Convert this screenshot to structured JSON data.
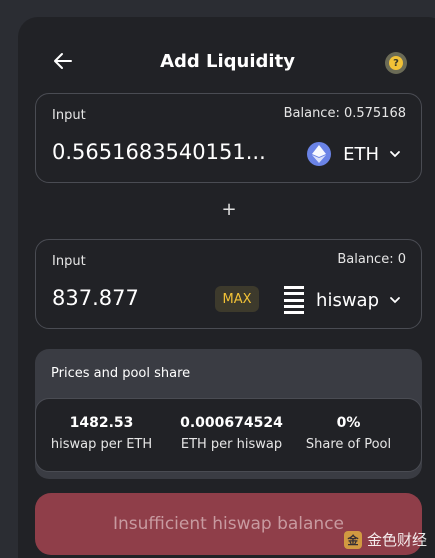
{
  "header": {
    "title": "Add Liquidity",
    "back_icon": "arrow-left-icon",
    "help_icon": "question-icon",
    "help_glyph": "?"
  },
  "input_a": {
    "label": "Input",
    "balance": "Balance: 0.575168",
    "amount": "0.5651683540151...",
    "token": "ETH",
    "token_icon": "ethereum-icon"
  },
  "plus": "+",
  "input_b": {
    "label": "Input",
    "balance": "Balance: 0",
    "amount": "837.877",
    "max_label": "MAX",
    "token": "hiswap",
    "token_icon": "hiswap-icon"
  },
  "pool": {
    "title": "Prices and pool share",
    "stats": [
      {
        "value": "1482.53",
        "label": "hiswap per ETH"
      },
      {
        "value": "0.000674524",
        "label": "ETH per hiswap"
      },
      {
        "value": "0%",
        "label": "Share of Pool"
      }
    ]
  },
  "submit": {
    "label": "Insufficient hiswap balance"
  },
  "watermark": {
    "text": "金色财经",
    "logo_glyph": "金"
  },
  "colors": {
    "background": "#2b2d33",
    "card": "#212226",
    "accent_yellow": "#f2c237",
    "eth_blue": "#6a83e6",
    "error_button": "#8f3e49"
  }
}
